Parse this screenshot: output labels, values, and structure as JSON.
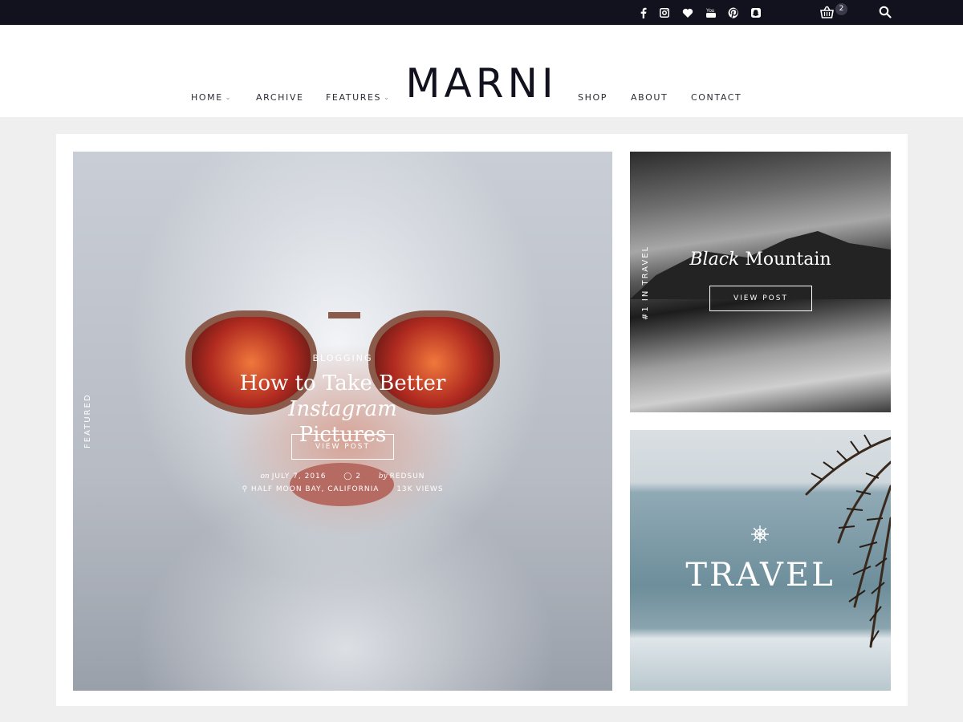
{
  "topbar": {
    "social_icons": [
      "facebook-icon",
      "instagram-icon",
      "heart-icon",
      "youtube-icon",
      "pinterest-icon",
      "snapchat-icon"
    ],
    "youtube_label": "You",
    "cart_count": "2"
  },
  "header": {
    "logo": "MARNI",
    "nav_left": [
      {
        "label": "HOME",
        "has_dropdown": true
      },
      {
        "label": "ARCHIVE",
        "has_dropdown": false
      },
      {
        "label": "FEATURES",
        "has_dropdown": true
      }
    ],
    "nav_right": [
      {
        "label": "SHOP"
      },
      {
        "label": "ABOUT"
      },
      {
        "label": "CONTACT"
      }
    ]
  },
  "featured_post": {
    "side_label": "FEATURED",
    "category": "BLOGGING",
    "title_part1": "How to Take Better ",
    "title_italic": "Instagram",
    "title_part2": "Pictures",
    "button": "VIEW POST",
    "date_prefix": "on",
    "date": "JULY 7, 2016",
    "comments": "2",
    "author_prefix": "by",
    "author": "REDSUN",
    "location": "HALF MOON BAY, CALIFORNIA",
    "views": "13K VIEWS"
  },
  "mountain_post": {
    "side_label": "#1 IN TRAVEL",
    "title_italic": "Black",
    "title_rest": " Mountain",
    "button": "VIEW POST"
  },
  "travel_post": {
    "title": "TRAVEL",
    "icon": "ship-wheel-icon"
  },
  "colors": {
    "topbar": "#12121f",
    "page_bg": "#efefef",
    "text_dark": "#2b2b33"
  }
}
